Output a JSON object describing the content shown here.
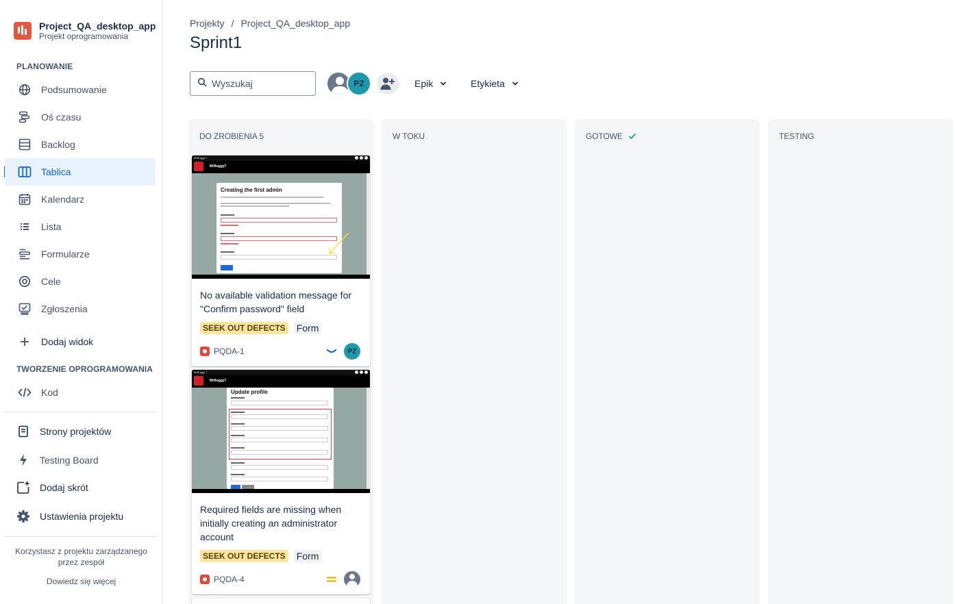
{
  "project": {
    "name": "Project_QA_desktop_app",
    "type": "Projekt oprogramowania"
  },
  "sidebar": {
    "planning_title": "PLANOWANIE",
    "items": [
      {
        "label": "Podsumowanie",
        "icon": "globe-icon"
      },
      {
        "label": "Oś czasu",
        "icon": "timeline-icon"
      },
      {
        "label": "Backlog",
        "icon": "backlog-icon"
      },
      {
        "label": "Tablica",
        "icon": "board-icon",
        "active": true
      },
      {
        "label": "Kalendarz",
        "icon": "calendar-icon"
      },
      {
        "label": "Lista",
        "icon": "list-icon"
      },
      {
        "label": "Formularze",
        "icon": "forms-icon"
      },
      {
        "label": "Cele",
        "icon": "goals-icon"
      },
      {
        "label": "Zgłoszenia",
        "icon": "issues-icon"
      }
    ],
    "add_view": "Dodaj widok",
    "dev_title": "TWORZENIE OPROGRAMOWANIA",
    "code": "Kod",
    "bottom_items": [
      {
        "label": "Strony projektów",
        "icon": "pages-icon"
      },
      {
        "label": "Testing Board",
        "icon": "bolt-icon"
      },
      {
        "label": "Dodaj skrót",
        "icon": "add-shortcut-icon"
      },
      {
        "label": "Ustawienia projektu",
        "icon": "gear-icon"
      }
    ],
    "footer_note": "Korzystasz z projektu zarządzanego przez zespół",
    "learn_more": "Dowiedz się więcej"
  },
  "breadcrumb": {
    "root": "Projekty",
    "separator": "/",
    "project": "Project_QA_desktop_app"
  },
  "page_title": "Sprint1",
  "search": {
    "placeholder": "Wyszukaj"
  },
  "avatars": {
    "pz_initials": "PZ"
  },
  "filters": {
    "epic": "Epik",
    "label": "Etykieta"
  },
  "columns": [
    {
      "title": "DO ZROBIENIA 5"
    },
    {
      "title": "W TOKU"
    },
    {
      "title": "GOTOWE",
      "done_check": true
    },
    {
      "title": "TESTING"
    }
  ],
  "cards": [
    {
      "title": "No available validation message for \"Confirm password\" field",
      "tag": "SEEK OUT DEFECTS",
      "label": "Form",
      "key": "PQDA-1",
      "priority": "low",
      "assignee": "PZ",
      "shot": {
        "window_title": "MrBuggy 7",
        "app_name": "MrBuggy7",
        "dialog_title": "Creating the first admin"
      }
    },
    {
      "title": "Required fields are missing when initially creating an administrator account",
      "tag": "SEEK OUT DEFECTS",
      "label": "Form",
      "key": "PQDA-4",
      "priority": "medium",
      "assignee": "",
      "shot": {
        "window_title": "MrBuggy 7",
        "app_name": "MrBuggy7",
        "dialog_title": "Update profile"
      }
    }
  ],
  "colors": {
    "accent": "#0c66e4",
    "active_bg": "#e9f2ff",
    "column_bg": "#f4f5f7",
    "tag_yellow": "#f8e6a0",
    "bug_red": "#e2483d",
    "priority_low": "#0c66e4",
    "priority_medium": "#e2b203",
    "done_green": "#22a06b"
  }
}
